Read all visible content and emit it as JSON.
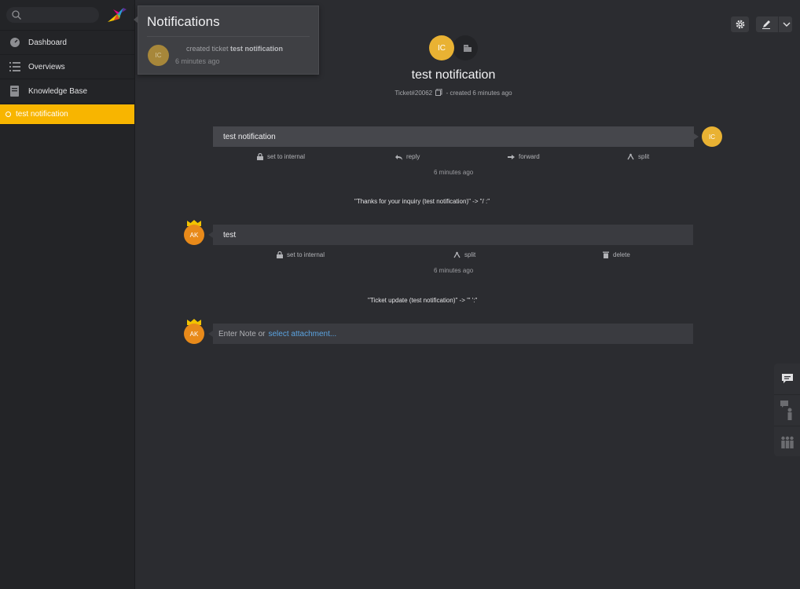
{
  "search": {
    "placeholder": ""
  },
  "sidebar": {
    "items": [
      {
        "label": "Dashboard",
        "icon": "dashboard-icon"
      },
      {
        "label": "Overviews",
        "icon": "list-icon"
      },
      {
        "label": "Knowledge Base",
        "icon": "book-icon"
      }
    ],
    "active_ticket": "test notification"
  },
  "notifications": {
    "title": "Notifications",
    "items": [
      {
        "avatar": "IC",
        "action": "created ticket",
        "target": "test notification",
        "time": "6 minutes ago"
      }
    ]
  },
  "ticket": {
    "avatar": "IC",
    "title": "test notification",
    "number": "Ticket#20062",
    "created": "- created 6 minutes ago"
  },
  "articles": [
    {
      "text": "test notification",
      "avatar": "IC",
      "actions": [
        "set to internal",
        "reply",
        "forward",
        "split"
      ],
      "time": "6 minutes ago",
      "system": "\"Thanks for your inquiry (test notification)\" -> \"/                          :\""
    },
    {
      "text": "test",
      "avatar": "AK",
      "actions": [
        "set to internal",
        "split",
        "delete"
      ],
      "time": "6 minutes ago",
      "system": "\"Ticket update (test notification)\" -> \"'                         ':\""
    }
  ],
  "composer": {
    "avatar": "AK",
    "placeholder": "Enter Note or",
    "link": "select attachment..."
  },
  "colors": {
    "accent": "#f8b500",
    "avatar_ic": "#e9b233",
    "avatar_ak": "#e88a1a",
    "link": "#5ba3e0"
  }
}
